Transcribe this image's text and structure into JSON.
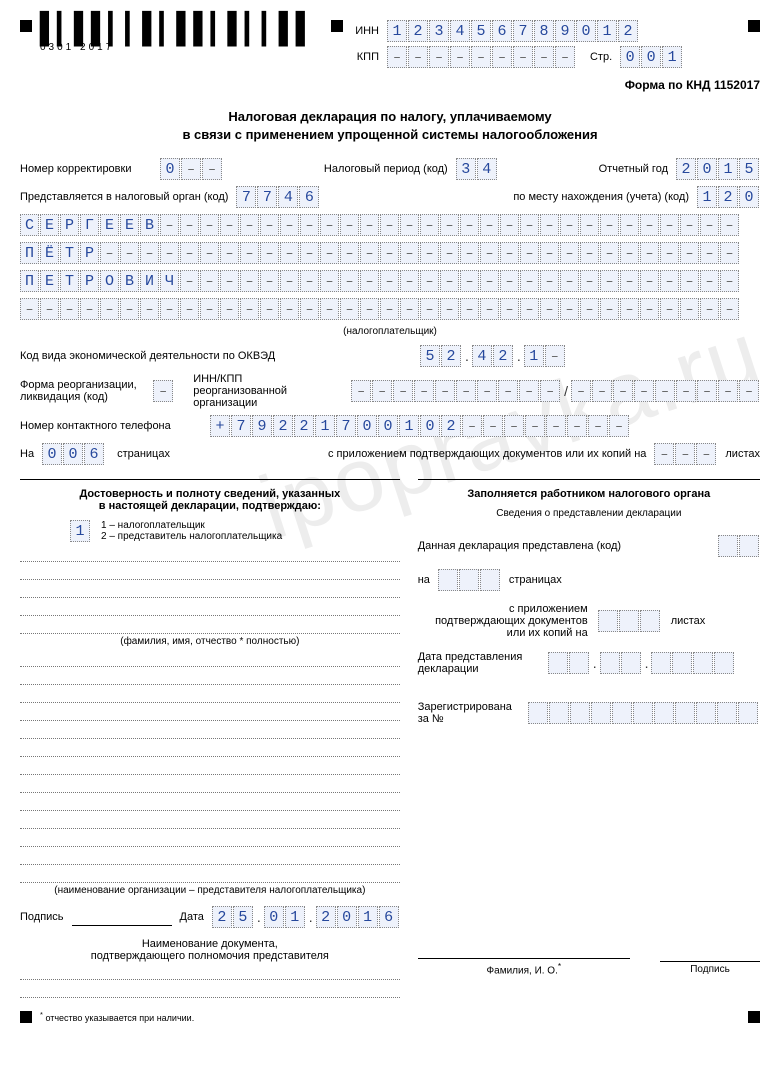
{
  "barcode_num": "0301 2017",
  "header": {
    "inn_label": "ИНН",
    "inn": "123456789012",
    "kpp_label": "КПП",
    "kpp": "---------",
    "page_label": "Стр.",
    "page": "001",
    "form_code": "Форма по КНД 1152017"
  },
  "title_line1": "Налоговая декларация по налогу, уплачиваемому",
  "title_line2": "в связи с применением упрощенной системы налогообложения",
  "r1": {
    "corr_label": "Номер корректировки",
    "corr": "0--",
    "period_label": "Налоговый период (код)",
    "period": "34",
    "year_label": "Отчетный год",
    "year": "2015"
  },
  "r2": {
    "org_label": "Представляется в налоговый орган (код)",
    "org": "7746",
    "place_label": "по месту нахождения (учета) (код)",
    "place": "120"
  },
  "name1": "СЕРГЕЕВ",
  "name2": "ПЁТР",
  "name3": "ПЕТРОВИЧ",
  "taxpayer_note": "(налогоплательщик)",
  "okved": {
    "label": "Код вида экономической деятельности по ОКВЭД",
    "p1": "52",
    "p2": "42",
    "p3": "1-"
  },
  "reorg": {
    "label1": "Форма реорганизации,",
    "label2": "ликвидация (код)",
    "code": "-",
    "inn_label1": "ИНН/КПП реорганизованной",
    "inn_label2": "организации",
    "inn": "----------",
    "kpp": "---------"
  },
  "phone": {
    "label": "Номер контактного телефона",
    "value": "+79221700102--------"
  },
  "pages": {
    "on_label": "На",
    "pages": "006",
    "pages_label": "страницах",
    "att_label": "с приложением подтверждающих документов или их копий на",
    "att": "---",
    "sheets_label": "листах"
  },
  "left": {
    "hd1": "Достоверность и полноту сведений, указанных",
    "hd2": "в настоящей декларации, подтверждаю:",
    "code": "1",
    "opt1": "1 – налогоплательщик",
    "opt2": "2 – представитель налогоплательщика",
    "fio_note": "(фамилия, имя, отчество * полностью)",
    "org_note": "(наименование организации – представителя налогоплательщика)",
    "sign_label": "Подпись",
    "date_label": "Дата",
    "date_d": "25",
    "date_m": "01",
    "date_y": "2016",
    "doc_hd1": "Наименование документа,",
    "doc_hd2": "подтверждающего полномочия представителя"
  },
  "right": {
    "hd": "Заполняется работником налогового органа",
    "sub_hd": "Сведения о представлении декларации",
    "presented": "Данная декларация представлена (код)",
    "on": "на",
    "pages_label": "страницах",
    "att1": "с приложением",
    "att2": "подтверждающих документов",
    "att3": "или их копий на",
    "sheets": "листах",
    "date1": "Дата представления",
    "date2": "декларации",
    "reg1": "Зарегистрирована",
    "reg2": "за №",
    "fio": "Фамилия, И. О.",
    "sign": "Подпись"
  },
  "footnote": "отчество указывается  при наличии."
}
